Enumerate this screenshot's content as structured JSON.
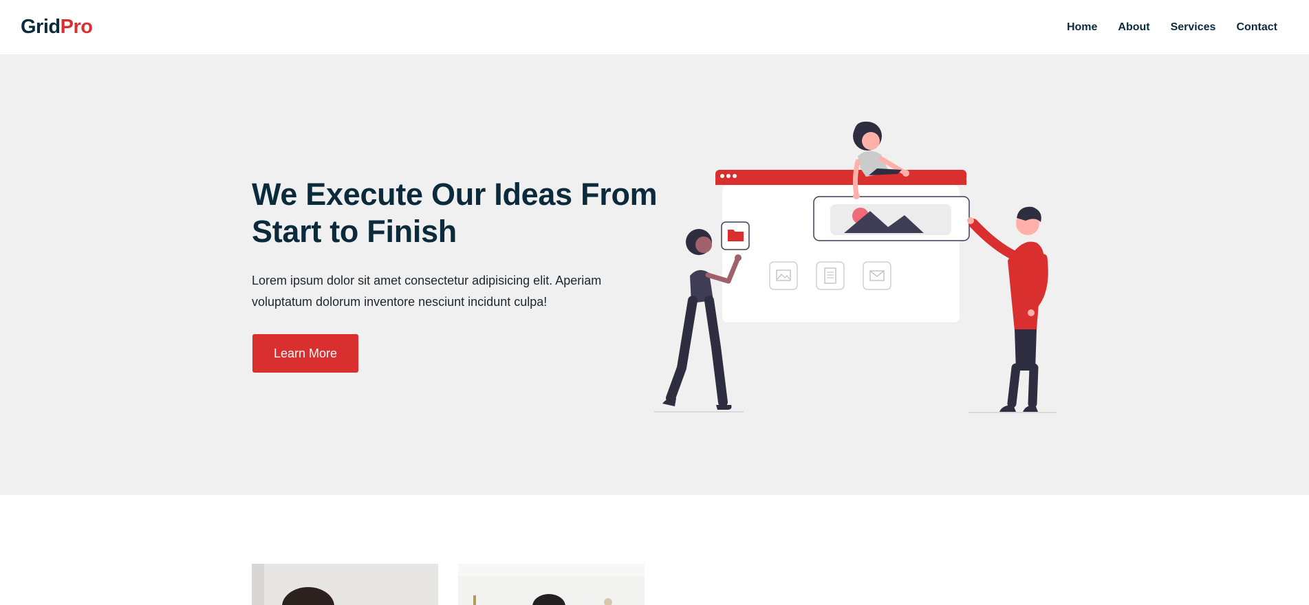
{
  "brand": {
    "part1": "Grid",
    "part2": "Pro",
    "accent_color": "#d92f2f",
    "dark_color": "#0b2a3c"
  },
  "nav": {
    "items": [
      "Home",
      "About",
      "Services",
      "Contact"
    ]
  },
  "hero": {
    "title": "We Execute Our Ideas From Start to Finish",
    "text": "Lorem ipsum dolor sit amet consectetur adipisicing elit. Aperiam voluptatum dolorum inventore nesciunt incidunt culpa!",
    "button_label": "Learn More",
    "background": "#f0f0f0"
  },
  "illustration": {
    "icons": [
      "folder-icon",
      "image-icon",
      "document-icon",
      "mail-icon"
    ]
  },
  "photos": [
    "person-photo",
    "person-photo"
  ]
}
